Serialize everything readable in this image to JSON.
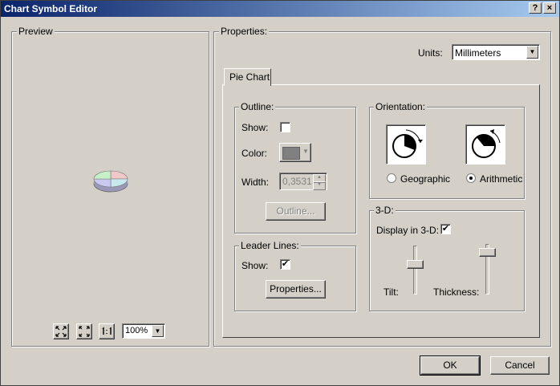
{
  "window": {
    "title": "Chart Symbol Editor",
    "help_label": "?",
    "close_label": "×"
  },
  "preview": {
    "label": "Preview",
    "zoom_value": "100%"
  },
  "properties": {
    "label": "Properties:",
    "units_label": "Units:",
    "units_value": "Millimeters",
    "tab_label": "Pie Chart",
    "outline": {
      "label": "Outline:",
      "show_label": "Show:",
      "color_label": "Color:",
      "width_label": "Width:",
      "width_value": "0,3531",
      "button_label": "Outline...",
      "show_checked": false
    },
    "leader_lines": {
      "label": "Leader Lines:",
      "show_label": "Show:",
      "show_checked": true,
      "button_label": "Properties..."
    },
    "orientation": {
      "label": "Orientation:",
      "geographic_label": "Geographic",
      "arithmetic_label": "Arithmetic",
      "selected": "Arithmetic"
    },
    "three_d": {
      "label": "3-D:",
      "display_label": "Display in 3-D:",
      "display_checked": true,
      "tilt_label": "Tilt:",
      "thickness_label": "Thickness:"
    }
  },
  "footer": {
    "ok_label": "OK",
    "cancel_label": "Cancel"
  },
  "colors": {
    "title_start": "#0a246a",
    "title_end": "#a6caf0",
    "pie_pink": "#f0c8c8",
    "pie_green": "#c8f0c8",
    "pie_blue": "#c8e8f0",
    "pie_purple": "#c8c8f0",
    "outline_swatch": "#808080"
  },
  "check_glyph": "✔",
  "dropdown_arrow": "▼"
}
